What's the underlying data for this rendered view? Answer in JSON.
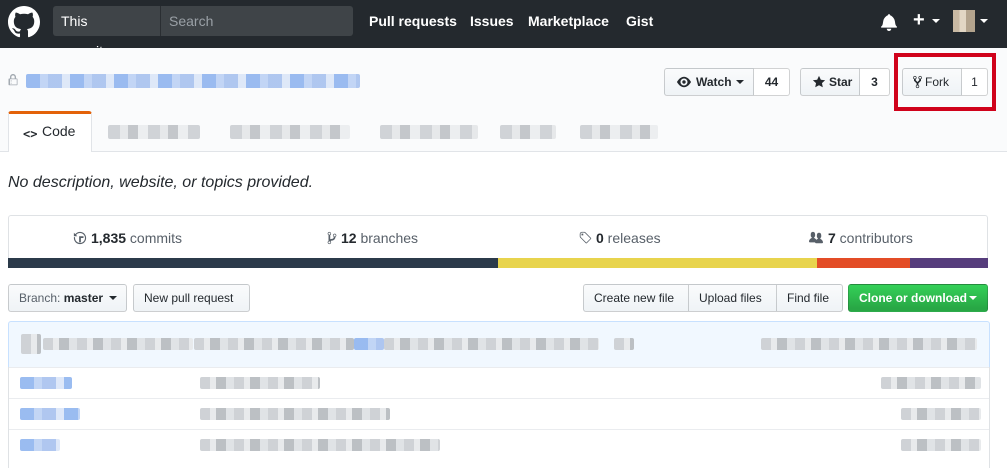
{
  "header": {
    "search_scope": "This repository",
    "search_placeholder": "Search",
    "nav": [
      "Pull requests",
      "Issues",
      "Marketplace",
      "Gist"
    ],
    "new_label": "+"
  },
  "repo": {
    "actions": {
      "watch_label": "Watch",
      "watch_count": "44",
      "star_label": "Star",
      "star_count": "3",
      "fork_label": "Fork",
      "fork_count": "1"
    },
    "tabs": {
      "code": "Code"
    }
  },
  "description": "No description, website, or topics provided.",
  "summary": {
    "commits_num": "1,835",
    "commits_label": " commits",
    "branches_num": "12",
    "branches_label": " branches",
    "releases_num": "0",
    "releases_label": " releases",
    "contributors_num": "7",
    "contributors_label": " contributors"
  },
  "language_bar": [
    {
      "color": "#2b3a4a",
      "fraction": 0.5
    },
    {
      "color": "#e8d44d",
      "fraction": 0.325
    },
    {
      "color": "#e34c26",
      "fraction": 0.095
    },
    {
      "color": "#563d7c",
      "fraction": 0.08
    }
  ],
  "file_nav": {
    "branch_prefix": "Branch:",
    "branch_name": "master",
    "new_pull_request": "New pull request",
    "create_new_file": "Create new file",
    "upload_files": "Upload files",
    "find_file": "Find file",
    "clone_or_download": "Clone or download"
  },
  "colors": {
    "header_bg": "#24292e",
    "clone_button": "#28a745",
    "highlight": "#d0021b",
    "tab_accent": "#e36209"
  }
}
